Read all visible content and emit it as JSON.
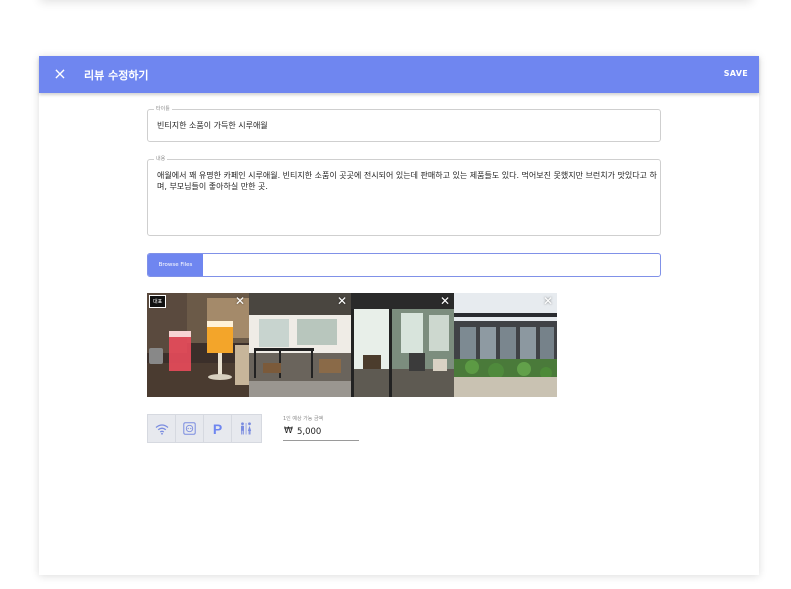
{
  "header": {
    "title": "리뷰 수정하기",
    "save_label": "SAVE",
    "close_icon": "×",
    "bar_color": "#6f86f0"
  },
  "form": {
    "title_label": "타이틀",
    "title_value": "빈티지한 소품이 가득한 시루애월",
    "content_label": "내용",
    "content_value": "애월에서 꽤 유명한 카페인 시루애월. 빈티지한 소품이 곳곳에 전시되어 있는데 판매하고 있는 제품들도 있다. 먹어보진 못했지만 브런치가 맛있다고 하며, 부모님들이 좋아하실 만한 곳.",
    "browse_label": "Browse Files",
    "file_value": ""
  },
  "photos": [
    {
      "name": "drinks-photo",
      "close": "✕",
      "badge": "대표"
    },
    {
      "name": "interior-photo",
      "close": "✕"
    },
    {
      "name": "terrace-photo",
      "close": "✕"
    },
    {
      "name": "exterior-photo",
      "close": "✕"
    }
  ],
  "amenities": [
    {
      "icon": "wifi-icon",
      "glyph": "wifi"
    },
    {
      "icon": "outlet-icon",
      "glyph": "outlet"
    },
    {
      "icon": "parking-icon",
      "glyph": "P"
    },
    {
      "icon": "restroom-icon",
      "glyph": "restroom"
    }
  ],
  "price": {
    "label": "1인 예상 가능 금액",
    "currency": "₩",
    "value": "5,000"
  }
}
